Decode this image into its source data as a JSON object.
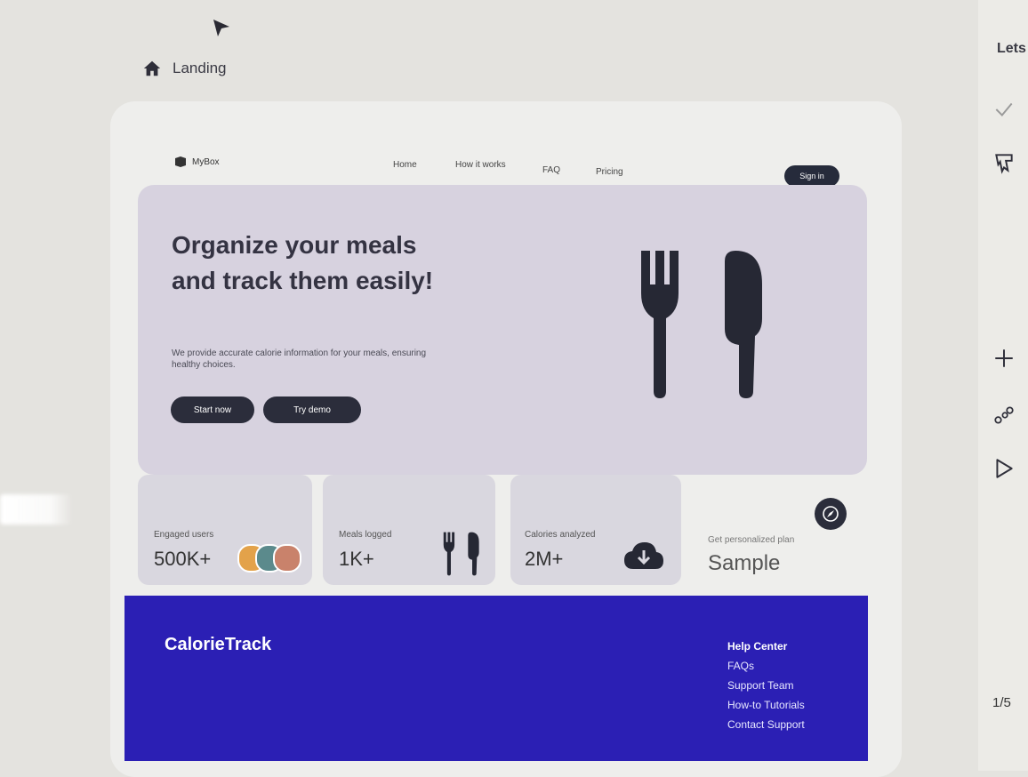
{
  "editor": {
    "breadcrumb": "Landing",
    "right_panel_text": "Lets",
    "page_indicator": "1/5"
  },
  "nav": {
    "brand": "MyBox",
    "links": [
      "Home",
      "How it works",
      "FAQ",
      "Pricing"
    ],
    "signin": "Sign in"
  },
  "hero": {
    "title_line1": "Organize your meals",
    "title_line2": "and track them easily!",
    "description": "We provide accurate calorie information for your meals, ensuring healthy choices.",
    "start_label": "Start now",
    "demo_label": "Try demo"
  },
  "stats": [
    {
      "label": "Engaged users",
      "value": "500K+"
    },
    {
      "label": "Meals logged",
      "value": "1K+"
    },
    {
      "label": "Calories analyzed",
      "value": "2M+"
    }
  ],
  "plan": {
    "label": "Get personalized plan",
    "value": "Sample"
  },
  "footer": {
    "logo": "CalorieTrack",
    "help_heading": "Help Center",
    "links": [
      "FAQs",
      "Support Team",
      "How-to Tutorials",
      "Contact Support"
    ]
  },
  "colors": {
    "hero_bg": "#d7d2df",
    "footer_bg": "#2b1fb4",
    "button_dark": "#2b2d3b"
  }
}
